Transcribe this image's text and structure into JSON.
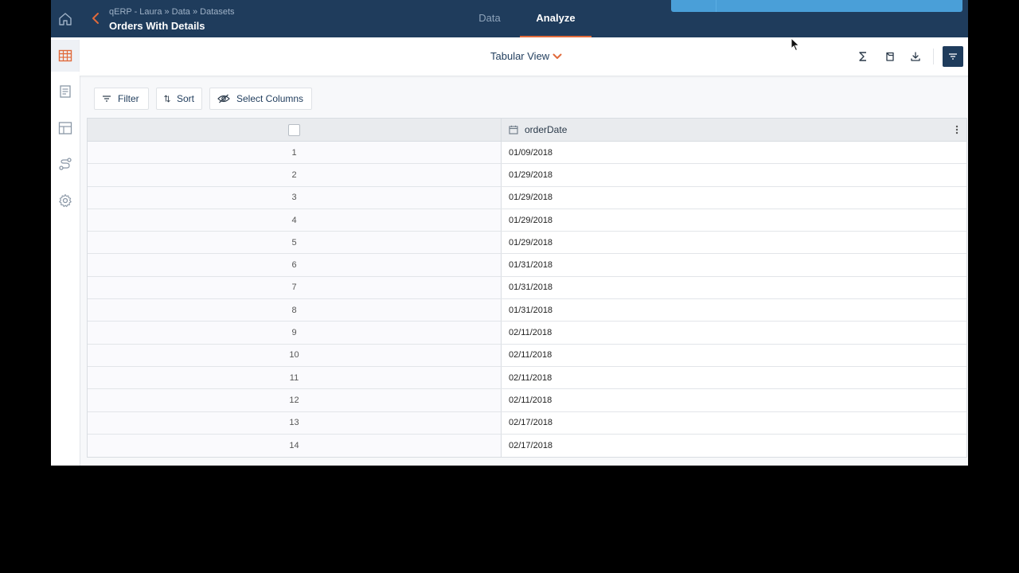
{
  "header": {
    "breadcrumb": "qERP - Laura » Data » Datasets",
    "title": "Orders With Details",
    "tabs": [
      {
        "label": "Data",
        "active": false
      },
      {
        "label": "Analyze",
        "active": true
      }
    ]
  },
  "rail": {
    "items": [
      {
        "icon": "home-icon"
      },
      {
        "icon": "table-icon",
        "active": true
      },
      {
        "icon": "document-icon"
      },
      {
        "icon": "layout-icon"
      },
      {
        "icon": "flow-icon"
      },
      {
        "icon": "gear-icon"
      }
    ]
  },
  "view": {
    "label": "Tabular View",
    "tools": [
      "sigma-icon",
      "bookmark-icon",
      "download-icon",
      "filter-panel-icon"
    ]
  },
  "toolbar": {
    "filter_label": "Filter",
    "sort_label": "Sort",
    "columns_label": "Select Columns"
  },
  "table": {
    "column_header": "orderDate",
    "rows": [
      {
        "n": "1",
        "date": "01/09/2018"
      },
      {
        "n": "2",
        "date": "01/29/2018"
      },
      {
        "n": "3",
        "date": "01/29/2018"
      },
      {
        "n": "4",
        "date": "01/29/2018"
      },
      {
        "n": "5",
        "date": "01/29/2018"
      },
      {
        "n": "6",
        "date": "01/31/2018"
      },
      {
        "n": "7",
        "date": "01/31/2018"
      },
      {
        "n": "8",
        "date": "01/31/2018"
      },
      {
        "n": "9",
        "date": "02/11/2018"
      },
      {
        "n": "10",
        "date": "02/11/2018"
      },
      {
        "n": "11",
        "date": "02/11/2018"
      },
      {
        "n": "12",
        "date": "02/11/2018"
      },
      {
        "n": "13",
        "date": "02/17/2018"
      },
      {
        "n": "14",
        "date": "02/17/2018"
      }
    ]
  },
  "colors": {
    "nav_bg": "#1f3c5c",
    "accent": "#e06a3b",
    "banner": "#4a9fd8"
  }
}
